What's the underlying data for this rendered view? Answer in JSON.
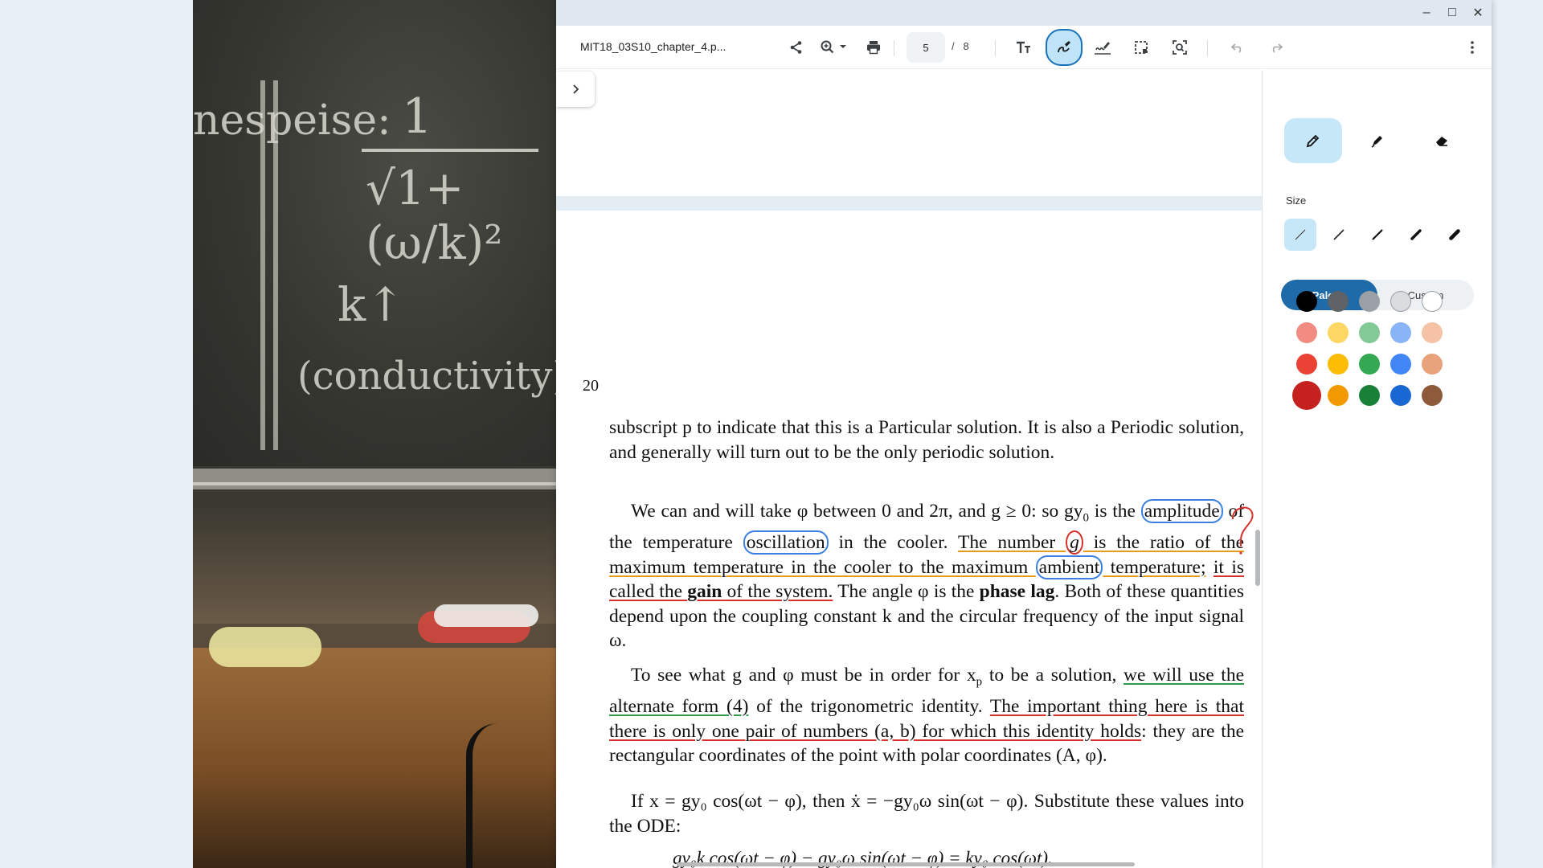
{
  "window": {
    "minimize": "–",
    "maximize": "□",
    "close": "✕"
  },
  "toolbar": {
    "doc_title": "MIT18_03S10_chapter_4.p...",
    "current_page": "5",
    "page_separator": "/",
    "total_pages": "8",
    "icons": [
      "share-icon",
      "zoom-icon",
      "print-icon",
      "text-icon",
      "draw-icon",
      "signature-icon",
      "select-area-icon",
      "screenshot-search-icon",
      "undo-icon",
      "redo-icon",
      "more-icon"
    ]
  },
  "document": {
    "page_number": "20",
    "para1": "subscript p to indicate that this is a Particular solution. It is also a Periodic solution, and generally will turn out to be the only periodic solution.",
    "para2_parts": {
      "a": "We can and will take φ between 0 and 2π, and g ≥ 0: so gy",
      "a_sub": "0",
      "b": " is the ",
      "amplitude": "amplitude",
      "c": " of the temperature ",
      "oscillation": "oscillation",
      "d": " in the cooler. ",
      "number": "The number ",
      "g": "g",
      "ratio": " is the ratio of the maximum temperature in the cooler to the maximum ",
      "ambient": "ambient",
      "temperature": " temperature;",
      "e": " ",
      "called": "it is called the ",
      "gain": "gain",
      "of_system": " of the system.",
      "f": " The angle φ is the ",
      "phase_lag": "phase lag",
      "h": ". Both of these quantities depend upon the coupling constant k and the circular frequency of the input signal ω."
    },
    "para3_parts": {
      "a": "To see what g and φ must be in order for x",
      "a_sub": "p",
      "b": " to be a solution, ",
      "alt": "we will use the alternate form (4)",
      "c": " of the trigonometric identity. ",
      "important": "The important thing here is that there is only one pair of numbers (a, b) for which this identity holds",
      "d": ": they are the rectangular coordinates of the point with polar coordinates (A, φ)."
    },
    "para4": "If x = gy₀ cos(ωt − φ), then ẋ = −gy₀ω sin(ωt − φ). Substitute these values into the ODE:",
    "equation": "gy₀k cos(ωt − φ) − gy₀ω sin(ωt − φ) = ky₀ cos(ωt).",
    "margin_note": "?"
  },
  "panel": {
    "size_label": "Size",
    "palette_label": "Palette",
    "custom_label": "Custom",
    "colors": [
      [
        "#000000",
        "#5f6368",
        "#9aa0a6",
        "#dadce0",
        "#ffffff"
      ],
      [
        "#f28b82",
        "#fdd663",
        "#81c995",
        "#8ab4f8",
        "#f6c2a6"
      ],
      [
        "#ea4335",
        "#fbbc04",
        "#34a853",
        "#4285f4",
        "#e8a27c"
      ],
      [
        "#c5221f",
        "#f29900",
        "#188038",
        "#1967d2",
        "#8d5a3b"
      ]
    ]
  }
}
